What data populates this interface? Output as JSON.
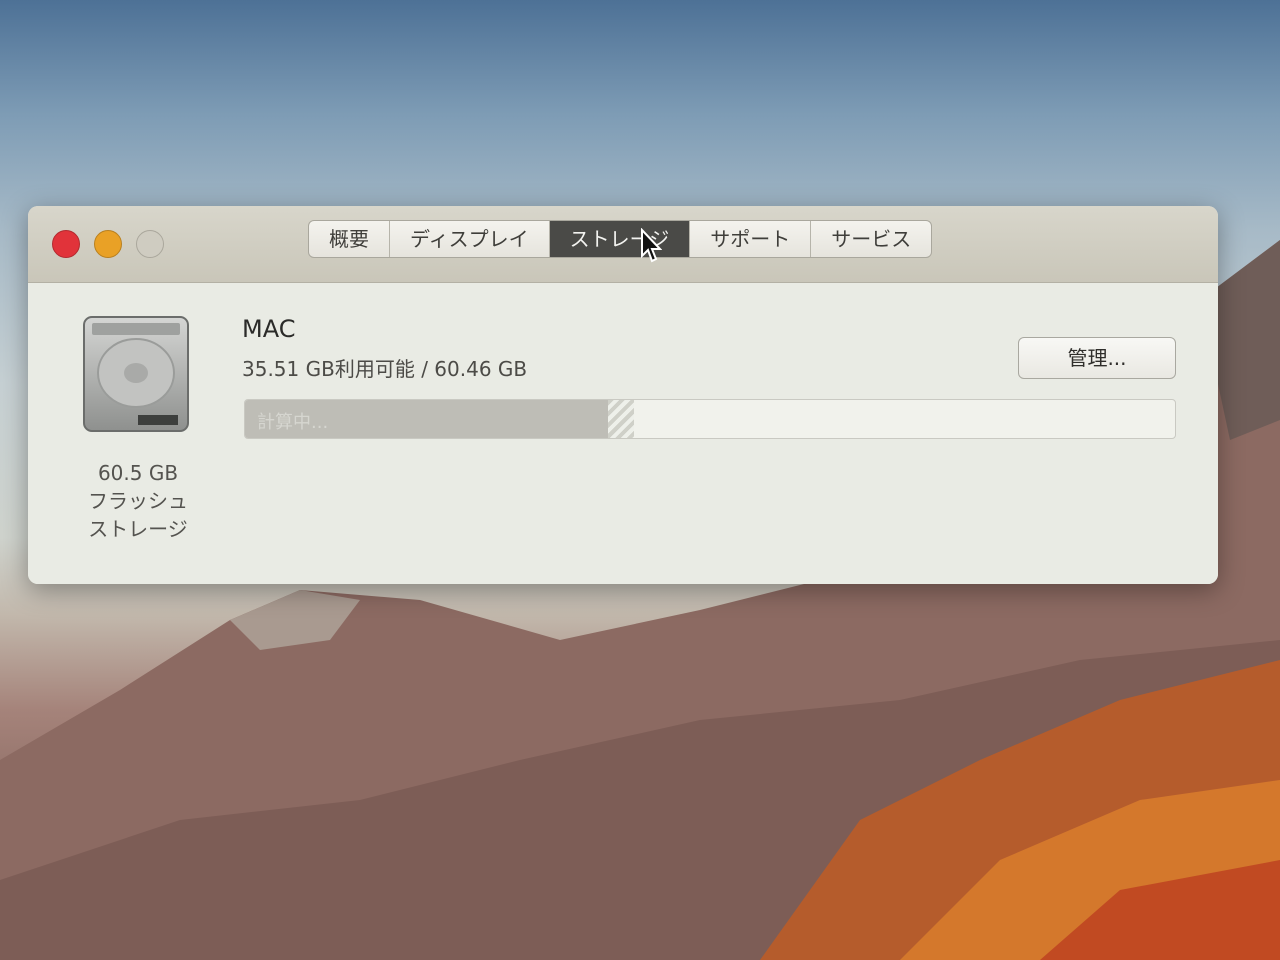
{
  "window": {
    "tabs": [
      {
        "label": "概要"
      },
      {
        "label": "ディスプレイ"
      },
      {
        "label": "ストレージ"
      },
      {
        "label": "サポート"
      },
      {
        "label": "サービス"
      }
    ],
    "active_tab": "ストレージ"
  },
  "storage": {
    "volume_name": "MAC",
    "space_text": "35.51 GB利用可能 / 60.46 GB",
    "bar_label": "計算中...",
    "used_fraction": 0.39,
    "manage_label": "管理...",
    "disk_caption": [
      "60.5 GB",
      "フラッシュ",
      "ストレージ"
    ]
  },
  "icons": {
    "close": "close-icon",
    "minimize": "minimize-icon",
    "zoom": "zoom-icon",
    "disk": "hard-drive-icon",
    "cursor": "pointer-cursor-icon"
  },
  "colors": {
    "close": "#e1333a",
    "minimize": "#e9a126",
    "zoom_inactive": "#cfccc1",
    "active_tab": "#4a4a47",
    "bar_used": "#bebdb6"
  }
}
